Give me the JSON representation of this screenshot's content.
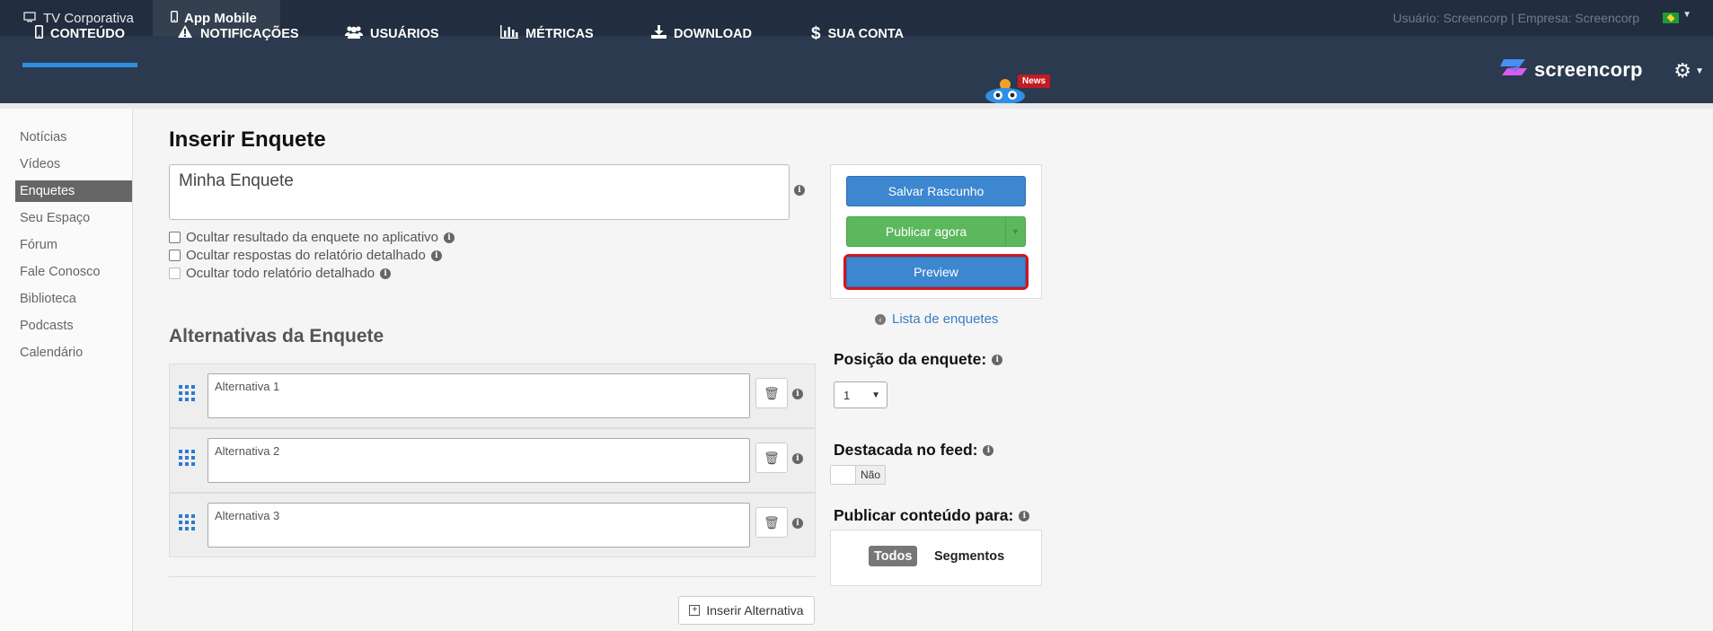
{
  "topbar": {
    "tabs": [
      {
        "label": "TV Corporativa",
        "icon": "monitor-icon"
      },
      {
        "label": "App Mobile",
        "icon": "mobile-icon"
      }
    ],
    "user_info": "Usuário: Screencorp | Empresa: Screencorp",
    "flag_icon": "brazil-flag-icon"
  },
  "nav": {
    "items": [
      {
        "label": "CONTEÚDO",
        "icon": "mobile-icon",
        "active": true
      },
      {
        "label": "NOTIFICAÇÕES",
        "icon": "warning-icon"
      },
      {
        "label": "USUÁRIOS",
        "icon": "users-icon"
      },
      {
        "label": "MÉTRICAS",
        "icon": "bar-chart-icon"
      },
      {
        "label": "DOWNLOAD",
        "icon": "download-icon"
      },
      {
        "label": "SUA CONTA",
        "icon": "dollar-icon"
      }
    ],
    "news_badge": "News",
    "logo_text": "screencorp"
  },
  "sidebar": {
    "items": [
      {
        "label": "Notícias"
      },
      {
        "label": "Vídeos"
      },
      {
        "label": "Enquetes",
        "active": true
      },
      {
        "label": "Seu Espaço"
      },
      {
        "label": "Fórum"
      },
      {
        "label": "Fale Conosco"
      },
      {
        "label": "Biblioteca"
      },
      {
        "label": "Podcasts"
      },
      {
        "label": "Calendário"
      }
    ]
  },
  "form": {
    "heading": "Inserir Enquete",
    "title_value": "Minha Enquete",
    "options": [
      {
        "label": "Ocultar resultado da enquete no aplicativo",
        "checked": false,
        "disabled": false
      },
      {
        "label": "Ocultar respostas do relatório detalhado",
        "checked": false,
        "disabled": false
      },
      {
        "label": "Ocultar todo relatório detalhado",
        "checked": false,
        "disabled": true
      }
    ],
    "alternatives_heading": "Alternativas da Enquete",
    "alternatives": [
      {
        "value": "Alternativa 1"
      },
      {
        "value": "Alternativa 2"
      },
      {
        "value": "Alternativa 3"
      }
    ],
    "insert_alternative_label": "Inserir Alternativa"
  },
  "actions": {
    "save_draft": "Salvar Rascunho",
    "publish_now": "Publicar agora",
    "preview": "Preview",
    "list_link": "Lista de enquetes"
  },
  "settings": {
    "position_label": "Posição da enquete:",
    "position_value": "1",
    "featured_label": "Destacada no feed:",
    "featured_value": "Não",
    "publish_to_label": "Publicar conteúdo para:",
    "publish_to_options": [
      "Todos",
      "Segmentos"
    ],
    "publish_to_selected": "Todos"
  },
  "colors": {
    "topbar": "#222d3f",
    "navbar": "#2b3a4e",
    "accent_blue": "#3c87cf",
    "accent_green": "#5cb85c",
    "highlight_red": "#d0161f",
    "news_red": "#c21b23"
  }
}
